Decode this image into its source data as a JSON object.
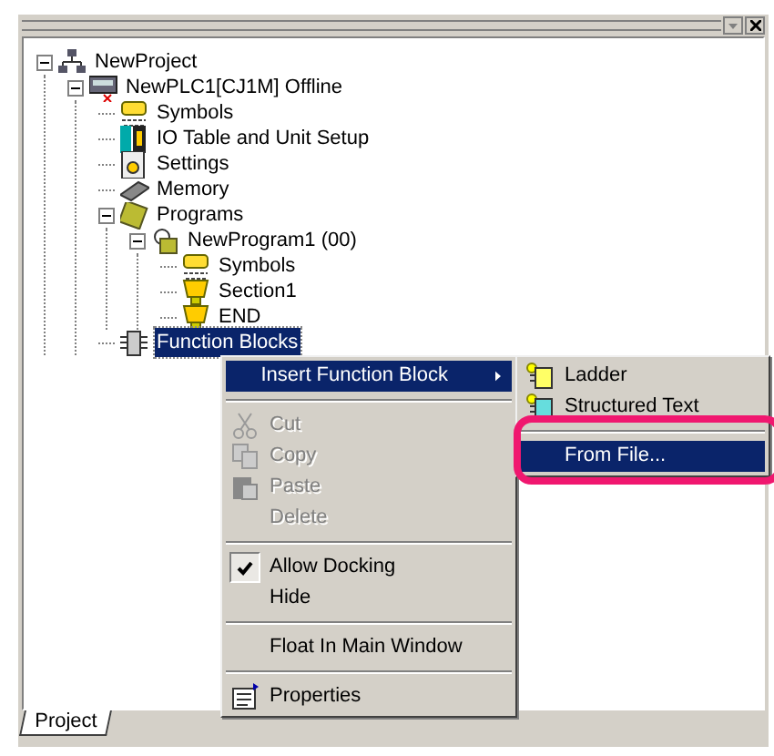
{
  "tree": [
    {
      "label": "NewProject",
      "kind": "network",
      "expanded": true,
      "selected": false,
      "children": [
        {
          "label": "NewPLC1[CJ1M] Offline",
          "kind": "plc",
          "expanded": true,
          "selected": false,
          "children": [
            {
              "label": "Symbols",
              "kind": "symbols",
              "selected": false
            },
            {
              "label": "IO Table and Unit Setup",
              "kind": "io",
              "selected": false
            },
            {
              "label": "Settings",
              "kind": "settings",
              "selected": false
            },
            {
              "label": "Memory",
              "kind": "memory",
              "selected": false
            },
            {
              "label": "Programs",
              "kind": "programs",
              "expanded": true,
              "selected": false,
              "children": [
                {
                  "label": "NewProgram1 (00)",
                  "kind": "program",
                  "expanded": true,
                  "selected": false,
                  "children": [
                    {
                      "label": "Symbols",
                      "kind": "symbols",
                      "selected": false
                    },
                    {
                      "label": "Section1",
                      "kind": "section",
                      "selected": false
                    },
                    {
                      "label": "END",
                      "kind": "section",
                      "selected": false
                    }
                  ]
                }
              ]
            },
            {
              "label": "Function Blocks",
              "kind": "fb",
              "selected": true
            }
          ]
        }
      ]
    }
  ],
  "context_menu": [
    {
      "kind": "submenu",
      "label": "Insert Function Block",
      "selected": true,
      "disabled": false
    },
    {
      "kind": "separator"
    },
    {
      "kind": "cut",
      "label": "Cut",
      "selected": false,
      "disabled": true
    },
    {
      "kind": "copy",
      "label": "Copy",
      "selected": false,
      "disabled": true
    },
    {
      "kind": "paste",
      "label": "Paste",
      "selected": false,
      "disabled": true
    },
    {
      "kind": "plain",
      "label": "Delete",
      "selected": false,
      "disabled": true
    },
    {
      "kind": "separator"
    },
    {
      "kind": "check",
      "label": "Allow Docking",
      "checked": true,
      "selected": false,
      "disabled": false
    },
    {
      "kind": "check",
      "label": "Hide",
      "checked": false,
      "selected": false,
      "disabled": false
    },
    {
      "kind": "separator"
    },
    {
      "kind": "plain",
      "label": "Float In Main Window",
      "selected": false,
      "disabled": false
    },
    {
      "kind": "separator"
    },
    {
      "kind": "properties",
      "label": "Properties",
      "selected": false,
      "disabled": false
    }
  ],
  "submenu": [
    {
      "kind": "ladder",
      "label": "Ladder",
      "selected": false
    },
    {
      "kind": "st",
      "label": "Structured Text",
      "selected": false
    },
    {
      "kind": "separator"
    },
    {
      "kind": "plain",
      "label": "From File...",
      "selected": true
    }
  ],
  "tabs": [
    {
      "label": "Project",
      "selected": true
    }
  ]
}
